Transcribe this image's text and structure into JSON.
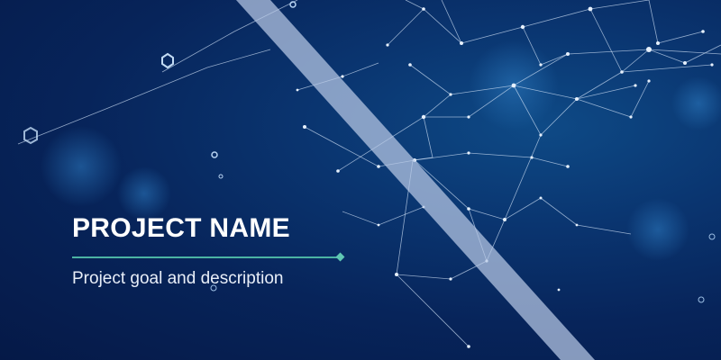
{
  "slide": {
    "title": "PROJECT NAME",
    "subtitle": "Project goal and description"
  },
  "colors": {
    "background_dark": "#051947",
    "background_mid": "#0a3570",
    "accent_line": "#4bb3a3",
    "stripe": "#b9c9e6",
    "title_text": "#ffffff"
  },
  "decor": {
    "network": "network-graph",
    "hexagons": "hexagon-outline-icon"
  }
}
